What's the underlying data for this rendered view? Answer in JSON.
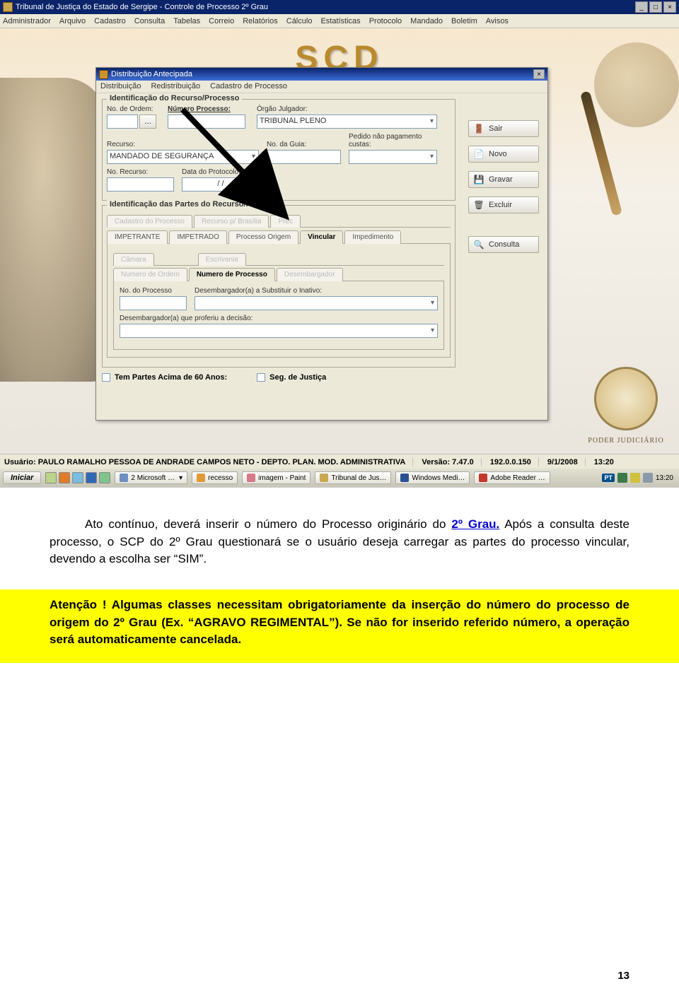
{
  "titlebar": {
    "text": "Tribunal de Justiça do Estado de Sergipe - Controle de Processo 2º Grau"
  },
  "menubar": {
    "items": [
      "Administrador",
      "Arquivo",
      "Cadastro",
      "Consulta",
      "Tabelas",
      "Correio",
      "Relatórios",
      "Cálculo",
      "Estatísticas",
      "Protocolo",
      "Mandado",
      "Boletim",
      "Avisos"
    ]
  },
  "decor": {
    "logo": "SCD",
    "crest_text": "PODER JUDICIÁRIO"
  },
  "dialog": {
    "title": "Distribuição Antecipada",
    "menu": [
      "Distribuição",
      "Redistribuição",
      "Cadastro de Processo"
    ],
    "fieldset1": {
      "legend": "Identificação do Recurso/Processo",
      "no_ordem_label": "No. de Ordem:",
      "numero_processo_label": "Número Processo:",
      "orgao_julgador_label": "Órgão Julgador:",
      "orgao_julgador_value": "TRIBUNAL PLENO",
      "recurso_label": "Recurso:",
      "recurso_value": "MANDADO DE SEGURANÇA",
      "no_guia_label": "No. da Guia:",
      "pedido_label": "Pedido não pagamento custas:",
      "no_recurso_label": "No. Recurso:",
      "data_protocolo_label": "Data do Protocolo:",
      "data_protocolo_value": "  /  /"
    },
    "fieldset2": {
      "legend": "Identificação das Partes do Recurso/Processo",
      "tabs_upper": [
        "Cadastro do Processo",
        "Recurso p/ Brasília",
        "Prec"
      ],
      "tabs_mid": [
        "IMPETRANTE",
        "IMPETRADO",
        "Processo Origem",
        "Vincular",
        "Impedimento"
      ],
      "tabs_inner1": [
        "Câmara",
        "Escrivania"
      ],
      "tabs_inner2": [
        "Numero de Ordem",
        "Numero de Processo",
        "Desembargador"
      ],
      "no_processo_label": "No. do Processo",
      "desemb_sub_label": "Desembargador(a) a Substituir o Inativo:",
      "desemb_dec_label": "Desembargador(a) que proferiu a decisão:"
    },
    "checkboxes": {
      "partes60": "Tem Partes Acima de 60 Anos:",
      "seg_justica": "Seg. de Justiça"
    },
    "buttons": {
      "sair": "Sair",
      "novo": "Novo",
      "gravar": "Gravar",
      "excluir": "Excluir",
      "consulta": "Consulta"
    }
  },
  "statusbar": {
    "usuario_label": "Usuário:",
    "usuario_value": "PAULO RAMALHO PESSOA DE ANDRADE CAMPOS NETO - DEPTO. PLAN. MOD. ADMINISTRATIVA",
    "versao_label": "Versão:",
    "versao_value": "7.47.0",
    "ip": "192.0.0.150",
    "date": "9/1/2008",
    "time": "13:20"
  },
  "taskbar": {
    "start": "Iniciar",
    "tasks": [
      "2 Microsoft …",
      "recesso",
      "imagem - Paint",
      "Tribunal de Jus…",
      "Windows Medi…",
      "Adobe Reader …"
    ],
    "tray_badge": "PT",
    "tray_time": "13:20"
  },
  "doc": {
    "para1_a": "Ato contínuo, deverá inserir o número do Processo originário do ",
    "para1_link": "2º Grau.",
    "para1_b": " Após a consulta deste processo, o SCP do 2º Grau questionará se o usuário deseja carregar as partes do processo vincular, devendo a escolha ser “SIM”.",
    "yellow": "Atenção ! Algumas classes necessitam obrigatoriamente da inserção do número do processo de origem do 2º Grau (Ex. “AGRAVO REGIMENTAL”). Se não for inserido referido número, a operação será automaticamente cancelada.",
    "page_number": "13"
  }
}
